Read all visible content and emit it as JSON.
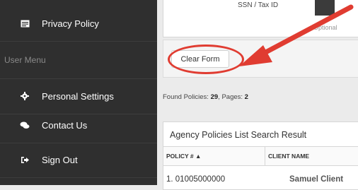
{
  "sidebar": {
    "privacy_policy": "Privacy Policy",
    "section_title": "User Menu",
    "items": [
      {
        "label": "Personal Settings",
        "icon": "gear-icon"
      },
      {
        "label": "Contact Us",
        "icon": "chat-bubbles-icon"
      },
      {
        "label": "Sign Out",
        "icon": "sign-out-icon"
      }
    ]
  },
  "form": {
    "ssn_label": "SSN / Tax ID",
    "optional_label": "Optional",
    "clear_button": "Clear Form"
  },
  "results": {
    "found_prefix": "Found Policies: ",
    "found_count": "29",
    "pages_prefix": ", Pages: ",
    "pages_count": "2",
    "title": "Agency Policies List Search Result",
    "columns": [
      "POLICY # ▲",
      "CLIENT NAME"
    ],
    "rows": [
      {
        "policy": "1. 01005000000",
        "client": "Samuel Client"
      }
    ]
  },
  "colors": {
    "sidebar_bg": "#2f2f2f",
    "annotation_red": "#e03c31"
  }
}
